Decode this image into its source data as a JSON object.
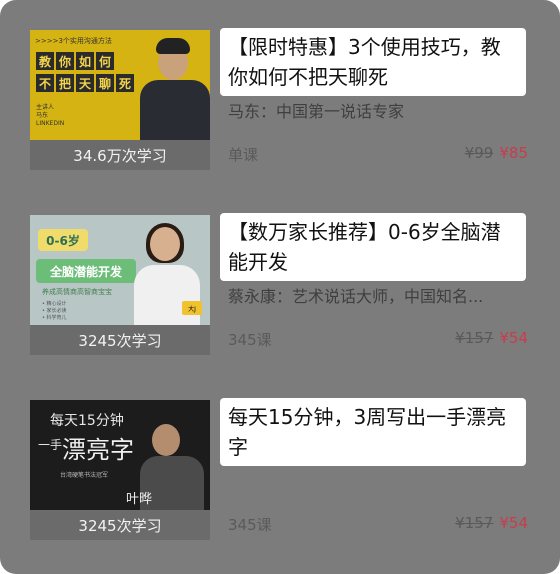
{
  "courses": [
    {
      "title": "【限时特惠】3个使用技巧，教你如何不把天聊死",
      "subtitle": "马东：中国第一说话专家",
      "learners": "34.6万次学习",
      "lessons": "单课",
      "original_price": "¥99",
      "price": "¥85",
      "thumb": {
        "tag": ">>>>3个实用沟通方法",
        "words": [
          "教",
          "你",
          "如",
          "何",
          "不",
          "把",
          "天",
          "聊",
          "死"
        ],
        "small_lines": [
          "主讲人",
          "马东",
          "LINKEDIN"
        ]
      }
    },
    {
      "title": "【数万家长推荐】0-6岁全脑潜能开发",
      "subtitle": "蔡永康：艺术说话大师，中国知名...",
      "learners": "3245次学习",
      "lessons": "345课",
      "original_price": "¥157",
      "price": "¥54",
      "thumb": {
        "badge": "0-6岁",
        "banner": "全脑潜能开发",
        "sub": "养成高情商高智商宝宝",
        "lines": [
          "• 精心设计",
          "• 家长必读",
          "• 科学育儿"
        ],
        "stamp": "大J"
      }
    },
    {
      "title": "每天15分钟，3周写出一手漂亮字",
      "subtitle": "",
      "learners": "3245次学习",
      "lessons": "345课",
      "original_price": "¥157",
      "price": "¥54",
      "thumb": {
        "line1": "每天15分钟",
        "line2": "一手",
        "big": "漂亮字",
        "small": "台湾硬笔书法冠军",
        "name": "叶晔"
      }
    }
  ],
  "colors": {
    "overlay": "#7c7c7c",
    "price_red": "#c83c4c"
  }
}
